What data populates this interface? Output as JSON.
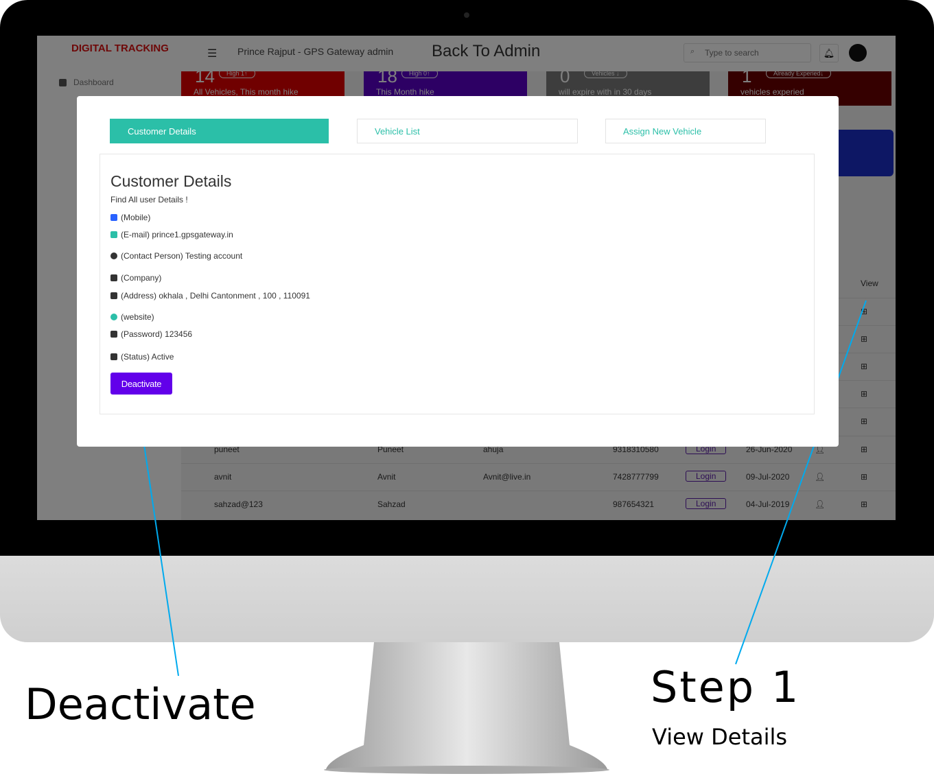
{
  "header": {
    "logo_text": "DIGITAL TRACKING",
    "user_title": "Prince Rajput - GPS Gateway admin",
    "back_link": "Back To Admin",
    "search_placeholder": "Type to search"
  },
  "sidebar": {
    "items": [
      "Dashboard"
    ]
  },
  "cards": [
    {
      "num": "14",
      "pill": "High 1↑",
      "sub": "All Vehicles, This month hike",
      "color": "#e00000"
    },
    {
      "num": "18",
      "pill": "High 0↑",
      "sub": "This Month hike",
      "color": "#5b00c8"
    },
    {
      "num": "0",
      "pill": "Vehicles ↓",
      "sub": "will expire with in 30 days",
      "color": "#7a7a7a"
    },
    {
      "num": "1",
      "pill": "Already  Experied↓",
      "sub": "vehicles experied",
      "color": "#6a0000"
    }
  ],
  "table": {
    "view_header": "View",
    "login_label": "Login",
    "rows": [
      {
        "username": "puneet",
        "name": "Puneet",
        "email": "ahuja",
        "mobile": "9318310580",
        "date": "26-Jun-2020"
      },
      {
        "username": "avnit",
        "name": "Avnit",
        "email": "Avnit@live.in",
        "mobile": "7428777799",
        "date": "09-Jul-2020"
      },
      {
        "username": "sahzad@123",
        "name": "Sahzad",
        "email": "",
        "mobile": "987654321",
        "date": "04-Jul-2019"
      }
    ]
  },
  "modal": {
    "tabs": [
      "Customer Details",
      "Vehicle List",
      "Assign New Vehicle"
    ],
    "title": "Customer Details",
    "subtitle": "Find All user Details !",
    "fields": [
      {
        "icon": "phone-icon",
        "text": "(Mobile)",
        "color": "#2962ff"
      },
      {
        "icon": "mail-icon",
        "text": "(E-mail) prince1.gpsgateway.in",
        "color": "#2bbfa8"
      },
      {
        "icon": "user-circle-icon",
        "text": "(Contact Person) Testing account",
        "color": "#333"
      },
      {
        "icon": "briefcase-icon",
        "text": "(Company)",
        "color": "#333"
      },
      {
        "icon": "building-icon",
        "text": "(Address) okhala , Delhi Cantonment , 100 , 110091",
        "color": "#333"
      },
      {
        "icon": "globe-icon",
        "text": "(website)",
        "color": "#2bbfa8"
      },
      {
        "icon": "key-icon",
        "text": "(Password) 123456",
        "color": "#333"
      },
      {
        "icon": "status-icon",
        "text": "(Status) Active",
        "color": "#333"
      }
    ],
    "deactivate_label": "Deactivate"
  },
  "annotations": {
    "deactivate": "Deactivate",
    "step": "Step 1",
    "step_sub": "View Details",
    "line_color": "#00aaee"
  }
}
